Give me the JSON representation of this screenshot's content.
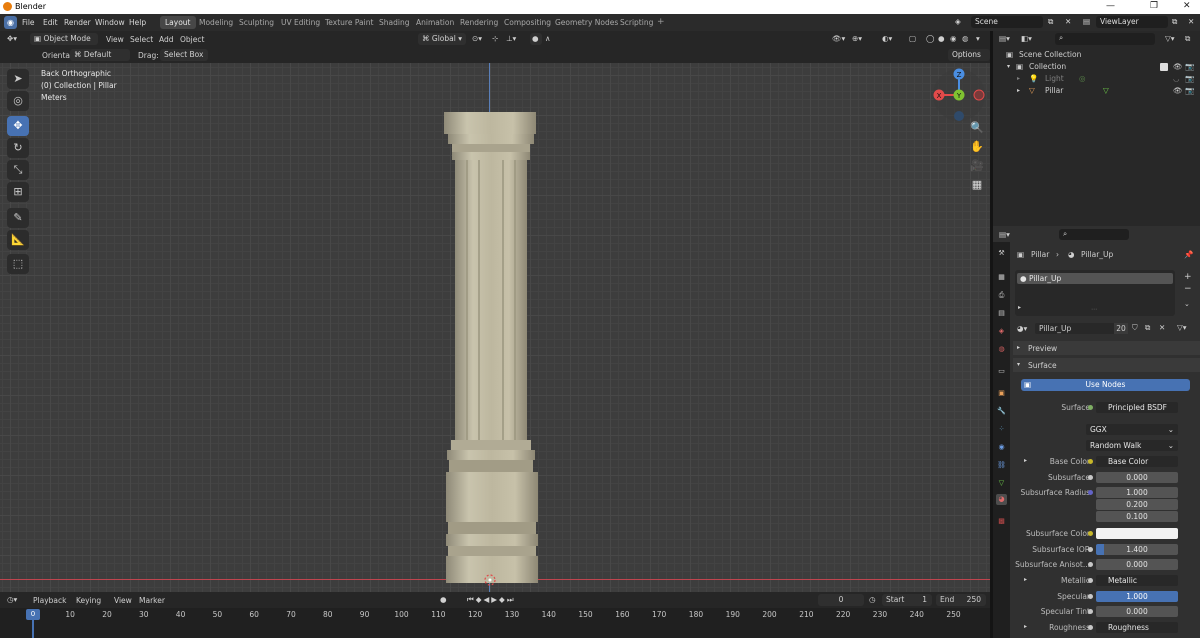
{
  "window": {
    "title": "Blender",
    "controls": [
      "—",
      "❐",
      "✕"
    ]
  },
  "menubar": {
    "menus": [
      "File",
      "Edit",
      "Render",
      "Window",
      "Help"
    ],
    "workspaces": [
      "Layout",
      "Modeling",
      "Sculpting",
      "UV Editing",
      "Texture Paint",
      "Shading",
      "Animation",
      "Rendering",
      "Compositing",
      "Geometry Nodes",
      "Scripting"
    ],
    "active_workspace": "Layout",
    "add_tab": "+",
    "scene": "Scene",
    "view_layer": "ViewLayer"
  },
  "viewport_header": {
    "mode": "Object Mode",
    "menus": [
      "View",
      "Select",
      "Add",
      "Object"
    ],
    "transform_orientation": "Global"
  },
  "tool_header": {
    "orientation_label": "Orientation:",
    "orientation_value": "Default",
    "drag_label": "Drag:",
    "drag_value": "Select Box",
    "options": "Options"
  },
  "viewport": {
    "view_name": "Back Orthographic",
    "collection_info": "(0) Collection | Pillar",
    "units": "Meters",
    "gizmo": {
      "x": "X",
      "y": "Y",
      "z": "Z"
    }
  },
  "timeline_header": {
    "menus": [
      "Playback",
      "Keying",
      "View",
      "Marker"
    ],
    "current_frame": "0",
    "start_label": "Start",
    "start_value": "1",
    "end_label": "End",
    "end_value": "250"
  },
  "timeline": {
    "frames": [
      "0",
      "10",
      "20",
      "30",
      "40",
      "50",
      "60",
      "70",
      "80",
      "90",
      "100",
      "110",
      "120",
      "130",
      "140",
      "150",
      "160",
      "170",
      "180",
      "190",
      "200",
      "210",
      "220",
      "230",
      "240",
      "250"
    ],
    "playhead": "0"
  },
  "outliner": {
    "root": "Scene Collection",
    "collection": "Collection",
    "items": [
      {
        "name": "Light",
        "dimmed": true
      },
      {
        "name": "Pillar",
        "dimmed": false
      }
    ]
  },
  "properties": {
    "breadcrumb_object": "Pillar",
    "breadcrumb_material": "Pillar_Up",
    "material_slot": "Pillar_Up",
    "material_name": "Pillar_Up",
    "user_count": "20",
    "panels": {
      "preview": "Preview",
      "surface": "Surface"
    },
    "use_nodes": "Use Nodes",
    "rows": [
      {
        "label": "Surface",
        "value": "Principled BSDF",
        "kind": "node"
      },
      {
        "label": "",
        "value": "GGX",
        "kind": "dropdown"
      },
      {
        "label": "",
        "value": "Random Walk",
        "kind": "dropdown"
      },
      {
        "label": "Base Color",
        "value": "Base Color",
        "kind": "node"
      },
      {
        "label": "Subsurface",
        "value": "0.000",
        "kind": "number"
      },
      {
        "label": "Subsurface Radius",
        "value": "1.000",
        "kind": "number"
      },
      {
        "label": "",
        "value": "0.200",
        "kind": "number"
      },
      {
        "label": "",
        "value": "0.100",
        "kind": "number"
      },
      {
        "label": "Subsurface Color",
        "value": "",
        "kind": "color"
      },
      {
        "label": "Subsurface IOR",
        "value": "1.400",
        "kind": "number"
      },
      {
        "label": "Subsurface Anisot...",
        "value": "0.000",
        "kind": "number"
      },
      {
        "label": "Metallic",
        "value": "Metallic",
        "kind": "node"
      },
      {
        "label": "Specular",
        "value": "1.000",
        "kind": "number-full"
      },
      {
        "label": "Specular Tint",
        "value": "0.000",
        "kind": "number"
      },
      {
        "label": "Roughness",
        "value": "Roughness",
        "kind": "node"
      }
    ]
  },
  "colors": {
    "accent": "#4772b3",
    "x_axis": "#e24a4a",
    "y_axis": "#7fc131",
    "z_axis": "#4a8ee2"
  }
}
